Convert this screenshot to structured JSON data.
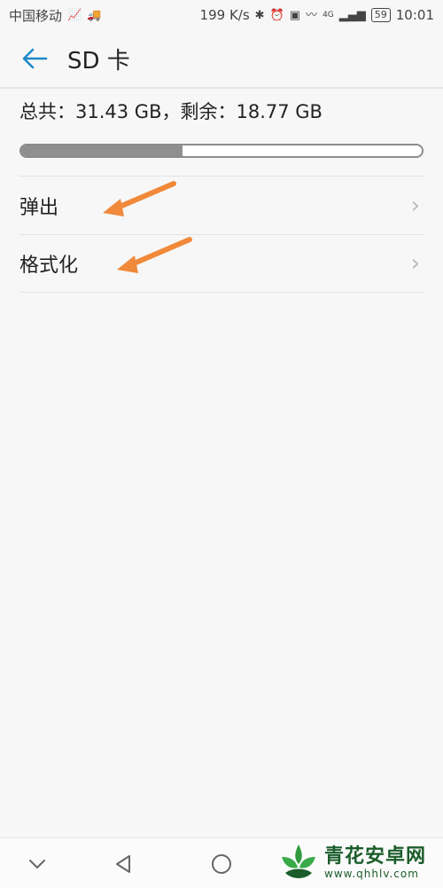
{
  "status_bar": {
    "carrier": "中国移动",
    "speed": "199 K/s",
    "network": "4G",
    "battery": "59",
    "time": "10:01"
  },
  "header": {
    "title": "SD 卡"
  },
  "storage": {
    "summary": "总共：31.43 GB，剩余：18.77 GB",
    "used_fraction": 0.403
  },
  "menu": {
    "items": [
      {
        "label": "弹出"
      },
      {
        "label": "格式化"
      }
    ]
  },
  "watermark": {
    "name": "青花安卓网",
    "url": "www.qhhlv.com"
  },
  "colors": {
    "accent": "#1e88c8",
    "annotation": "#f0893a",
    "bar_fill": "#8f8f8f"
  }
}
